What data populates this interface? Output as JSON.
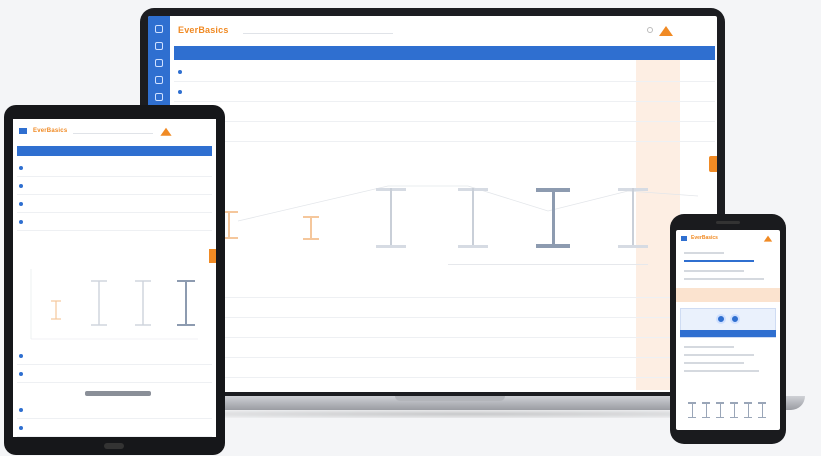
{
  "laptop": {
    "brand": "EverBasics",
    "section_title_prefix": "",
    "columns": [
      "",
      "",
      "",
      "",
      "",
      "",
      "",
      "",
      ""
    ],
    "rows": [
      {
        "name": "",
        "c1": "",
        "c2": "",
        "link": "",
        "c4": "",
        "c5": "",
        "c6": ""
      },
      {
        "name": "",
        "c1": "",
        "c2": "",
        "link": "",
        "c4": "",
        "c5": "",
        "c6": ""
      }
    ]
  },
  "tablet": {
    "brand": "EverBasics"
  },
  "phone": {
    "brand": "EverBasics"
  },
  "colors": {
    "primary_blue": "#2f6fd0",
    "accent_orange": "#f08a24",
    "tint_orange": "#fdeee3"
  },
  "icons": [
    "menu-icon",
    "bell-icon",
    "logo-icon",
    "search-icon"
  ]
}
